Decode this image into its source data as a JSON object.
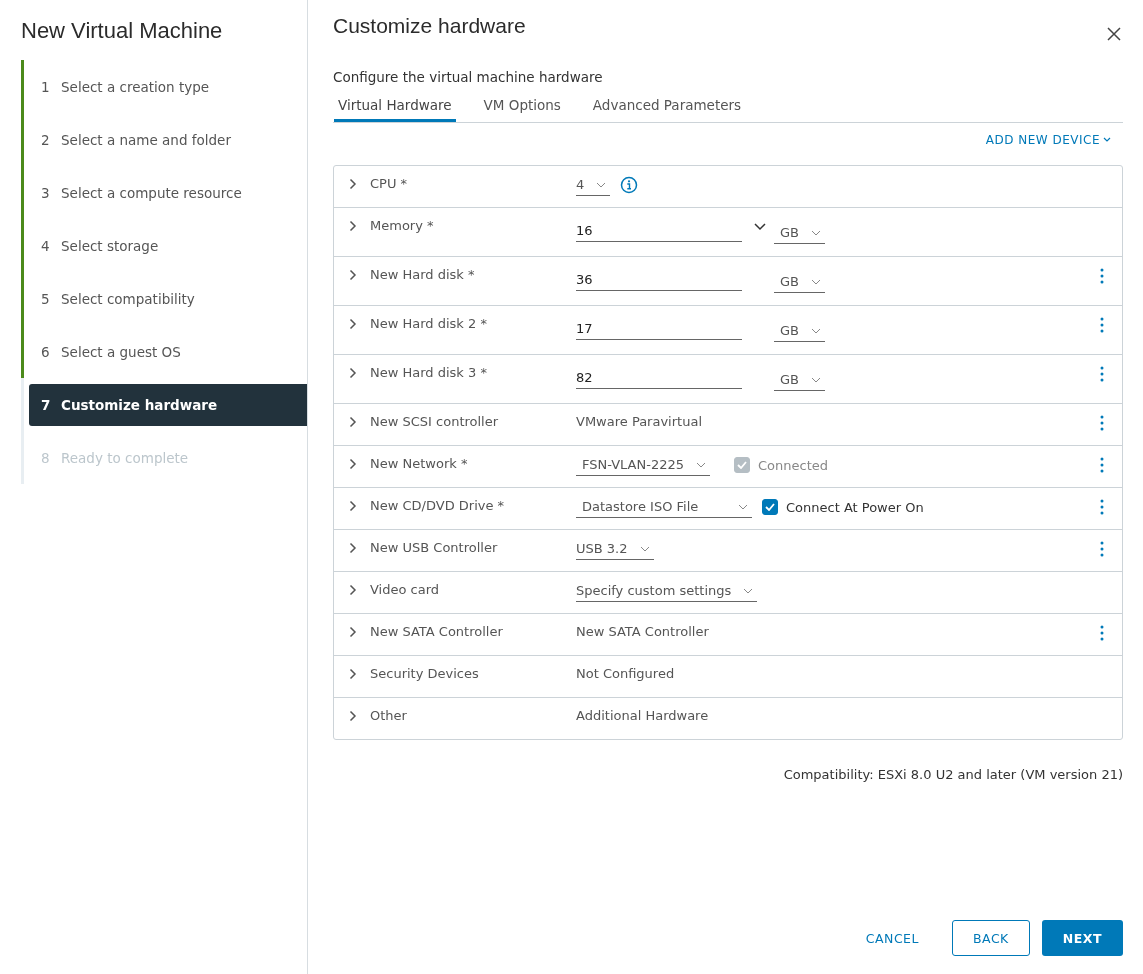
{
  "wizard": {
    "title": "New Virtual Machine",
    "steps": [
      {
        "number": "1",
        "label": "Select a creation type",
        "completed": true,
        "disabled": false,
        "selected": false
      },
      {
        "number": "2",
        "label": "Select a name and folder",
        "completed": true,
        "disabled": false,
        "selected": false
      },
      {
        "number": "3",
        "label": "Select a compute resource",
        "completed": true,
        "disabled": false,
        "selected": false
      },
      {
        "number": "4",
        "label": "Select storage",
        "completed": true,
        "disabled": false,
        "selected": false
      },
      {
        "number": "5",
        "label": "Select compatibility",
        "completed": true,
        "disabled": false,
        "selected": false
      },
      {
        "number": "6",
        "label": "Select a guest OS",
        "completed": true,
        "disabled": false,
        "selected": false
      },
      {
        "number": "7",
        "label": "Customize hardware",
        "completed": false,
        "disabled": false,
        "selected": true
      },
      {
        "number": "8",
        "label": "Ready to complete",
        "completed": false,
        "disabled": true,
        "selected": false
      }
    ]
  },
  "page": {
    "title": "Customize hardware",
    "subtitle": "Configure the virtual machine hardware"
  },
  "tabs": [
    {
      "label": "Virtual Hardware",
      "selected": true
    },
    {
      "label": "VM Options",
      "selected": false
    },
    {
      "label": "Advanced Parameters",
      "selected": false
    }
  ],
  "add_device": "ADD NEW DEVICE",
  "devices": [
    {
      "kind": "select",
      "label": "CPU *",
      "value": "4",
      "info": true,
      "menu": false
    },
    {
      "kind": "size_combo",
      "label": "Memory *",
      "value": "16",
      "unit": "GB",
      "menu": false
    },
    {
      "kind": "size",
      "label": "New Hard disk *",
      "value": "36",
      "unit": "GB",
      "menu": true
    },
    {
      "kind": "size",
      "label": "New Hard disk 2 *",
      "value": "17",
      "unit": "GB",
      "menu": true
    },
    {
      "kind": "size",
      "label": "New Hard disk 3 *",
      "value": "82",
      "unit": "GB",
      "menu": true
    },
    {
      "kind": "text",
      "label": "New SCSI controller",
      "value": "VMware Paravirtual",
      "menu": true
    },
    {
      "kind": "select_check",
      "label": "New Network *",
      "value": "FSN-VLAN-2225",
      "check_label": "Connected",
      "checked": true,
      "disabled": true,
      "menu": true
    },
    {
      "kind": "select_check",
      "label": "New CD/DVD Drive *",
      "value": "Datastore ISO File",
      "check_label": "Connect At Power On",
      "checked": true,
      "disabled": false,
      "menu": true
    },
    {
      "kind": "select",
      "label": "New USB Controller",
      "value": "USB 3.2",
      "info": false,
      "menu": true
    },
    {
      "kind": "select",
      "label": "Video card",
      "value": "Specify custom settings",
      "info": false,
      "menu": false
    },
    {
      "kind": "text",
      "label": "New SATA Controller",
      "value": "New SATA Controller",
      "menu": true
    },
    {
      "kind": "text",
      "label": "Security Devices",
      "value": "Not Configured",
      "menu": false
    },
    {
      "kind": "text",
      "label": "Other",
      "value": "Additional Hardware",
      "menu": false
    }
  ],
  "compatibility": "Compatibility: ESXi 8.0 U2 and later (VM version 21)",
  "buttons": [
    {
      "kind": "flat",
      "label": "CANCEL"
    },
    {
      "kind": "outline",
      "label": "BACK"
    },
    {
      "kind": "primary",
      "label": "NEXT"
    }
  ]
}
